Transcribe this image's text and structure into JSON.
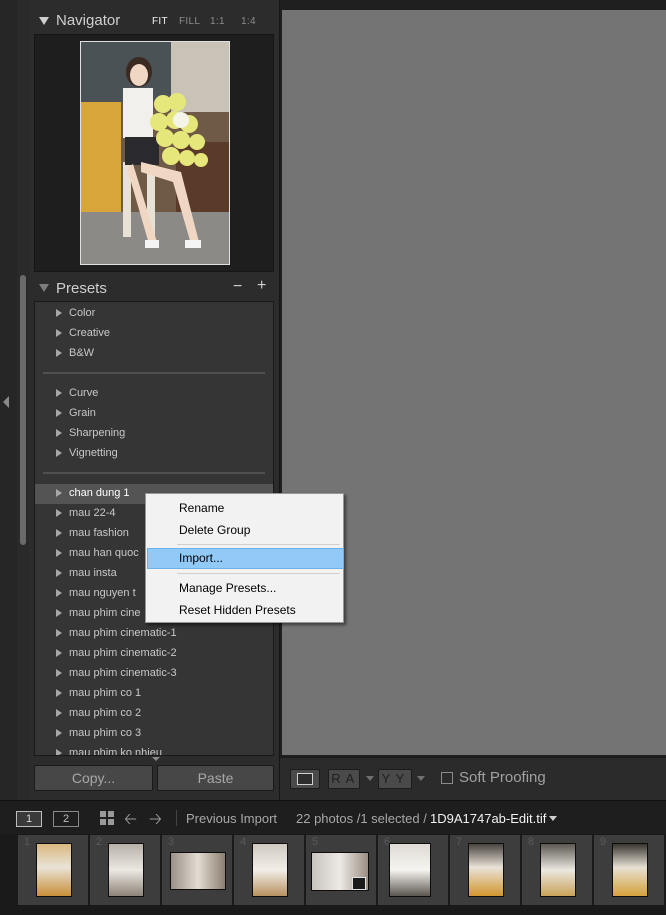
{
  "navigator": {
    "title": "Navigator",
    "zoom_options": [
      "FIT",
      "FILL",
      "1:1",
      "1:4"
    ],
    "active_zoom": "FIT"
  },
  "presets": {
    "title": "Presets",
    "minus_label": "−",
    "plus_label": "+",
    "groups": [
      {
        "items": [
          {
            "label": "Color"
          },
          {
            "label": "Creative"
          },
          {
            "label": "B&W"
          }
        ]
      },
      {
        "items": [
          {
            "label": "Curve"
          },
          {
            "label": "Grain"
          },
          {
            "label": "Sharpening"
          },
          {
            "label": "Vignetting"
          }
        ]
      },
      {
        "items": [
          {
            "label": "chan dung 1",
            "selected": true
          },
          {
            "label": "mau 22-4"
          },
          {
            "label": "mau fashion"
          },
          {
            "label": "mau han quoc"
          },
          {
            "label": "mau insta"
          },
          {
            "label": "mau nguyen t"
          },
          {
            "label": "mau phim cine"
          },
          {
            "label": "mau phim cinematic-1"
          },
          {
            "label": "mau phim cinematic-2"
          },
          {
            "label": "mau phim cinematic-3"
          },
          {
            "label": "mau phim co 1"
          },
          {
            "label": "mau phim co 2"
          },
          {
            "label": "mau phim co 3"
          },
          {
            "label": "mau phim ko nhieu"
          }
        ]
      }
    ]
  },
  "buttons": {
    "copy": "Copy...",
    "paste": "Paste"
  },
  "toolbar": {
    "ra": [
      "R",
      "A"
    ],
    "yy": [
      "Y",
      "Y"
    ],
    "soft_proofing": "Soft Proofing",
    "soft_proofing_checked": false
  },
  "context_menu": {
    "items": [
      "Rename",
      "Delete Group",
      "Import...",
      "Manage Presets...",
      "Reset Hidden Presets"
    ],
    "highlighted": "Import..."
  },
  "filmstrip_bar": {
    "monitor_1": "1",
    "monitor_2": "2",
    "source": "Previous Import",
    "count": "22 photos /1 selected /",
    "filename": "1D9A1747ab-Edit.tif"
  },
  "filmstrip": {
    "cells": [
      {
        "num": "1",
        "orientation": "portrait"
      },
      {
        "num": "2",
        "orientation": "portrait"
      },
      {
        "num": "3",
        "orientation": "landscape"
      },
      {
        "num": "4",
        "orientation": "portrait"
      },
      {
        "num": "5",
        "orientation": "landscape",
        "badge": true
      },
      {
        "num": "6",
        "orientation": "portrait"
      },
      {
        "num": "7",
        "orientation": "portrait"
      },
      {
        "num": "8",
        "orientation": "portrait"
      },
      {
        "num": "9",
        "orientation": "portrait"
      }
    ]
  },
  "colors": {
    "panel_bg": "#2c2c2c",
    "main_view_bg": "#747474",
    "menu_highlight": "#91c9f7",
    "selected_row": "#545454"
  }
}
